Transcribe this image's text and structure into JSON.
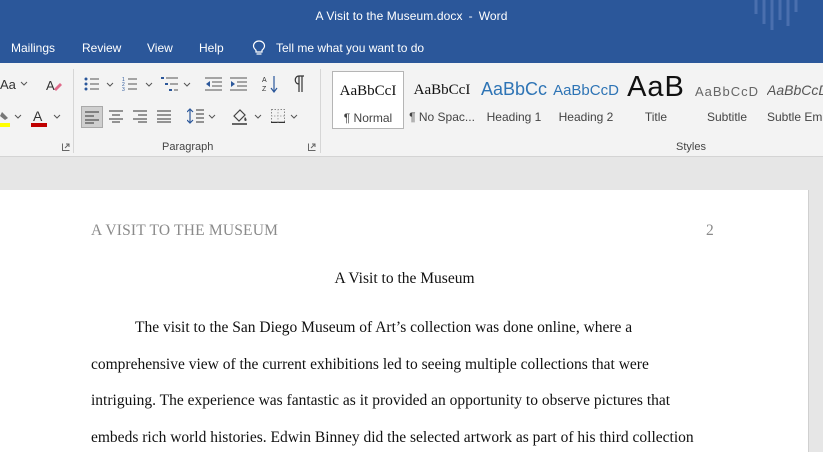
{
  "window": {
    "doc_name": "A Visit to the Museum.docx",
    "separator": "-",
    "app_name": "Word"
  },
  "tabs": [
    {
      "label": "Mailings"
    },
    {
      "label": "Review"
    },
    {
      "label": "View"
    },
    {
      "label": "Help"
    }
  ],
  "tell_me": {
    "text": "Tell me what you want to do",
    "icon": "lightbulb-icon"
  },
  "ribbon": {
    "font_group": {
      "font_size_label": "Aa",
      "font_color": "#c00000",
      "highlight_color": "#ffff00"
    },
    "paragraph_group": {
      "label": "Paragraph"
    },
    "styles_group": {
      "label": "Styles",
      "items": [
        {
          "preview": "AaBbCcI",
          "name": "¶ Normal"
        },
        {
          "preview": "AaBbCcI",
          "name": "¶ No Spac..."
        },
        {
          "preview": "AaBbCc",
          "name": "Heading 1"
        },
        {
          "preview": "AaBbCcD",
          "name": "Heading 2"
        },
        {
          "preview": "AaB",
          "name": "Title"
        },
        {
          "preview": "AaBbCcD",
          "name": "Subtitle"
        },
        {
          "preview": "AaBbCcD",
          "name": "Subtle Em..."
        }
      ]
    }
  },
  "document": {
    "running_head": "A VISIT TO THE MUSEUM",
    "page_number": "2",
    "title": "A Visit to the Museum",
    "lines": [
      "The visit to the San Diego Museum of Art’s collection was done online, where a",
      "comprehensive view of the current exhibitions led to seeing multiple collections that were",
      "intriguing. The experience was fantastic as it provided an opportunity to observe pictures that",
      "embeds rich world histories. Edwin Binney did the selected artwork as part of his third collection"
    ]
  },
  "colors": {
    "title_bar": "#2b579a",
    "heading_blue": "#2e74b5"
  }
}
